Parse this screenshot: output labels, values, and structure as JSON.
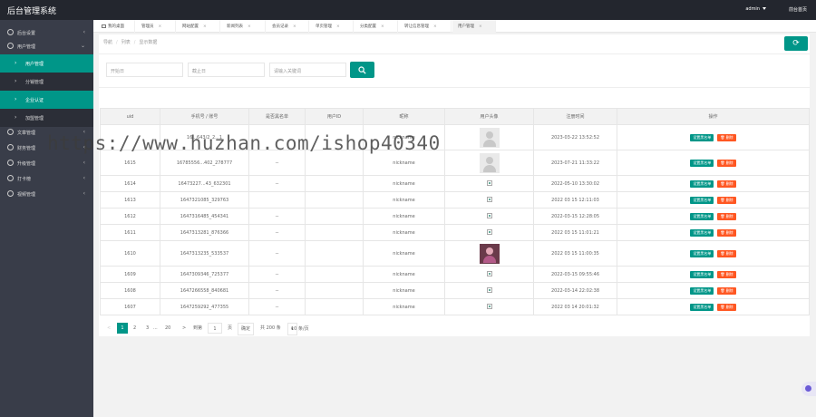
{
  "header": {
    "title": "后台管理系统",
    "user": "admin",
    "home": "前台首页"
  },
  "sidebar": {
    "items": [
      {
        "label": "后台设置",
        "icon": "gear-icon"
      },
      {
        "label": "用户管理",
        "icon": "user-icon"
      },
      {
        "label": "文章管理",
        "icon": "article-icon"
      },
      {
        "label": "财务管理",
        "icon": "money-icon"
      },
      {
        "label": "升级管理",
        "icon": "upgrade-icon"
      },
      {
        "label": "打卡榜",
        "icon": "checkin-icon"
      },
      {
        "label": "视频管理",
        "icon": "video-icon"
      }
    ],
    "sub_items": [
      {
        "label": "用户管理",
        "active": true
      },
      {
        "label": "分销管理",
        "active": false
      },
      {
        "label": "企业认证",
        "active": true
      },
      {
        "label": "加盟管理",
        "active": false
      }
    ]
  },
  "tabs": [
    {
      "label": "我的桌面",
      "closable": false
    },
    {
      "label": "管理员",
      "closable": true
    },
    {
      "label": "网站配置",
      "closable": true
    },
    {
      "label": "新闻列表",
      "closable": true
    },
    {
      "label": "会员记录",
      "closable": true
    },
    {
      "label": "单页管理",
      "closable": true
    },
    {
      "label": "分类配置",
      "closable": true
    },
    {
      "label": "转让信息管理",
      "closable": true
    },
    {
      "label": "用户管理",
      "closable": true,
      "active": true
    }
  ],
  "breadcrumb": [
    "导航",
    "列表",
    "显示数据"
  ],
  "filters": {
    "start_placeholder": "开始日",
    "end_placeholder": "截止日",
    "keyword_placeholder": "请输入关键词"
  },
  "table": {
    "headers": [
      "uid",
      "手机号 / 账号",
      "是否黑名单",
      "用户ID",
      "昵称",
      "用户头像",
      "注册时间",
      "操作"
    ],
    "rows": [
      {
        "uid": "",
        "phone": "16...643/2_2...1",
        "black": "",
        "userid": "",
        "nick": "nickname",
        "avatar": "default",
        "time": "2023-03-22 13:52:52",
        "btn1": "设置黑名单",
        "btn2": "删除"
      },
      {
        "uid": "1615",
        "phone": "16785556...402_278777",
        "black": "--",
        "userid": "",
        "nick": "nickname",
        "avatar": "default",
        "time": "2023-07-21 11:33:22",
        "btn1": "设置黑名单",
        "btn2": "删除"
      },
      {
        "uid": "1614",
        "phone": "16473227...43_632301",
        "black": "--",
        "userid": "",
        "nick": "nickname",
        "avatar": "broken",
        "time": "2022-05-10 13:30:02",
        "btn1": "设置黑名单",
        "btn2": "删除"
      },
      {
        "uid": "1613",
        "phone": "1647321085_329763",
        "black": "",
        "userid": "",
        "nick": "nickname",
        "avatar": "broken",
        "time": "2022 03 15 12:11:03",
        "btn1": "设置黑名单",
        "btn2": "删除"
      },
      {
        "uid": "1612",
        "phone": "1647316485_454341",
        "black": "--",
        "userid": "",
        "nick": "nickname",
        "avatar": "broken",
        "time": "2022-03-15 12:28:05",
        "btn1": "设置黑名单",
        "btn2": "删除"
      },
      {
        "uid": "1611",
        "phone": "1647313281_876366",
        "black": "--",
        "userid": "",
        "nick": "nickname",
        "avatar": "broken",
        "time": "2022 03 15 11:01:21",
        "btn1": "设置黑名单",
        "btn2": "删除"
      },
      {
        "uid": "1610",
        "phone": "1647313235_533537",
        "black": "--",
        "userid": "",
        "nick": "nickname",
        "avatar": "photo",
        "time": "2022 03 15 11:00:35",
        "btn1": "设置黑名单",
        "btn2": "删除"
      },
      {
        "uid": "1609",
        "phone": "1647309346_725377",
        "black": "--",
        "userid": "",
        "nick": "nickname",
        "avatar": "broken",
        "time": "2022-03-15 09:55:46",
        "btn1": "设置黑名单",
        "btn2": "删除"
      },
      {
        "uid": "1608",
        "phone": "1647266558_840681",
        "black": "--",
        "userid": "",
        "nick": "nickname",
        "avatar": "broken",
        "time": "2022-03-14 22:02:38",
        "btn1": "设置黑名单",
        "btn2": "删除"
      },
      {
        "uid": "1607",
        "phone": "1647259292_477355",
        "black": "--",
        "userid": "",
        "nick": "nickname",
        "avatar": "broken",
        "time": "2022 03 14 20:01:32",
        "btn1": "设置黑名单",
        "btn2": "删除"
      }
    ]
  },
  "pagination": {
    "prev": "<",
    "pages": [
      "1",
      "2",
      "3"
    ],
    "ellipsis": "...",
    "last": "20",
    "next": ">",
    "goto_label": "到第",
    "goto_value": "1",
    "page_unit": "页",
    "confirm": "确定",
    "total": "共 200 条",
    "per_page": "10 条/页"
  },
  "watermark": "https://www.huzhan.com/ishop40340",
  "colors": {
    "accent": "#009688",
    "danger": "#ff5722",
    "sidebar": "#393d49",
    "topbar": "#23262e"
  }
}
